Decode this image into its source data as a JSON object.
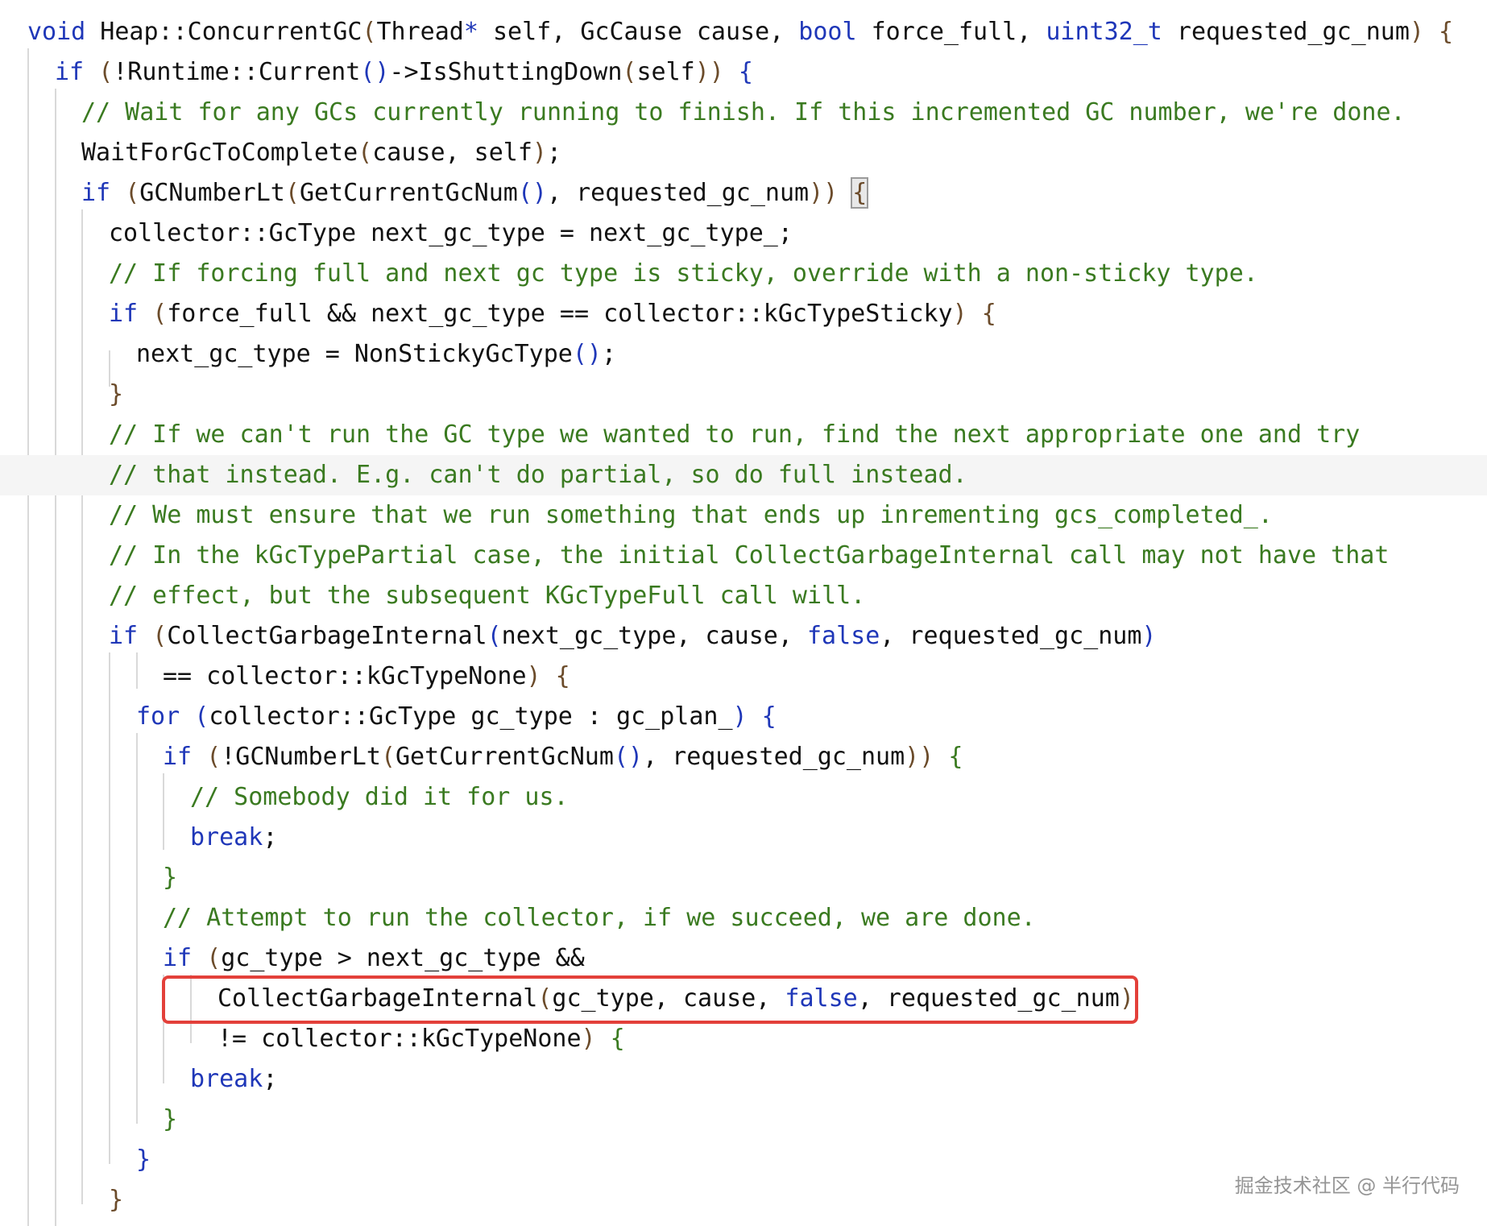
{
  "code": {
    "lines": [
      {
        "segments": [
          [
            "kw",
            "void"
          ],
          [
            "",
            " Heap::ConcurrentGC"
          ],
          [
            "pn",
            "("
          ],
          [
            "",
            "Thread"
          ],
          [
            "kw",
            "*"
          ],
          [
            "",
            " self, GcCause cause, "
          ],
          [
            "kw",
            "bool"
          ],
          [
            "",
            " force_full, "
          ],
          [
            "kw",
            "uint32_t"
          ],
          [
            "",
            " requested_gc_num"
          ],
          [
            "pn",
            ")"
          ],
          [
            "pn",
            " {"
          ]
        ]
      },
      {
        "segments": [
          [
            "kw",
            "if"
          ],
          [
            "",
            " "
          ],
          [
            "pn",
            "("
          ],
          [
            "",
            "!Runtime::Current"
          ],
          [
            "pr",
            "()"
          ],
          [
            "",
            "->IsShuttingDown"
          ],
          [
            "pn",
            "("
          ],
          [
            "",
            "self"
          ],
          [
            "pn",
            "))"
          ],
          [
            "pr",
            " {"
          ]
        ]
      },
      {
        "segments": [
          [
            "cm",
            "// Wait for any GCs currently running to finish. If this incremented GC number, we're done."
          ]
        ]
      },
      {
        "segments": [
          [
            "",
            "WaitForGcToComplete"
          ],
          [
            "pn",
            "("
          ],
          [
            "",
            "cause, self"
          ],
          [
            "pn",
            ")"
          ],
          [
            "",
            ";"
          ]
        ]
      },
      {
        "segments": [
          [
            "kw",
            "if"
          ],
          [
            "",
            " "
          ],
          [
            "pn",
            "("
          ],
          [
            "",
            "GCNumberLt"
          ],
          [
            "pn",
            "("
          ],
          [
            "",
            "GetCurrentGcNum"
          ],
          [
            "pr",
            "()"
          ],
          [
            "",
            ", requested_gc_num"
          ],
          [
            "pn",
            "))"
          ],
          [
            "",
            " "
          ],
          [
            "brace",
            "{"
          ]
        ]
      },
      {
        "segments": [
          [
            "",
            "collector::GcType next_gc_type = next_gc_type_;"
          ]
        ]
      },
      {
        "segments": [
          [
            "cm",
            "// If forcing full and next gc type is sticky, override with a non-sticky type."
          ]
        ]
      },
      {
        "segments": [
          [
            "kw",
            "if"
          ],
          [
            "",
            " "
          ],
          [
            "pn",
            "("
          ],
          [
            "",
            "force_full && next_gc_type == collector::kGcTypeSticky"
          ],
          [
            "pn",
            ")"
          ],
          [
            "pn",
            " {"
          ]
        ]
      },
      {
        "segments": [
          [
            "",
            "next_gc_type = NonStickyGcType"
          ],
          [
            "pr",
            "()"
          ],
          [
            "",
            ";"
          ]
        ]
      },
      {
        "segments": [
          [
            "pn",
            "}"
          ]
        ]
      },
      {
        "segments": [
          [
            "cm",
            "// If we can't run the GC type we wanted to run, find the next appropriate one and try"
          ]
        ]
      },
      {
        "segments": [
          [
            "cm",
            "// that instead. E.g. can't do partial, so do full instead."
          ]
        ]
      },
      {
        "segments": [
          [
            "cm",
            "// We must ensure that we run something that ends up inrementing gcs_completed_."
          ]
        ]
      },
      {
        "segments": [
          [
            "cm",
            "// In the kGcTypePartial case, the initial CollectGarbageInternal call may not have that"
          ]
        ]
      },
      {
        "segments": [
          [
            "cm",
            "// effect, but the subsequent KGcTypeFull call will."
          ]
        ]
      },
      {
        "segments": [
          [
            "kw",
            "if"
          ],
          [
            "",
            " "
          ],
          [
            "pn",
            "("
          ],
          [
            "",
            "CollectGarbageInternal"
          ],
          [
            "pr",
            "("
          ],
          [
            "",
            "next_gc_type, cause, "
          ],
          [
            "kw",
            "false"
          ],
          [
            "",
            ", requested_gc_num"
          ],
          [
            "pr",
            ")"
          ]
        ]
      },
      {
        "segments": [
          [
            "",
            "== collector::kGcTypeNone"
          ],
          [
            "pn",
            ")"
          ],
          [
            "pn",
            " {"
          ]
        ]
      },
      {
        "segments": [
          [
            "kw",
            "for"
          ],
          [
            "",
            " "
          ],
          [
            "pr",
            "("
          ],
          [
            "",
            "collector::GcType gc_type : gc_plan_"
          ],
          [
            "pr",
            ")"
          ],
          [
            "pr",
            " {"
          ]
        ]
      },
      {
        "segments": [
          [
            "kw",
            "if"
          ],
          [
            "",
            " "
          ],
          [
            "pn",
            "("
          ],
          [
            "",
            "!GCNumberLt"
          ],
          [
            "pn",
            "("
          ],
          [
            "",
            "GetCurrentGcNum"
          ],
          [
            "pr",
            "()"
          ],
          [
            "",
            ", requested_gc_num"
          ],
          [
            "pn",
            "))"
          ],
          [
            "cm",
            " {"
          ]
        ]
      },
      {
        "segments": [
          [
            "cm",
            "// Somebody did it for us."
          ]
        ]
      },
      {
        "segments": [
          [
            "kw",
            "break"
          ],
          [
            "",
            ";"
          ]
        ]
      },
      {
        "segments": [
          [
            "cm",
            "}"
          ]
        ]
      },
      {
        "segments": [
          [
            "cm",
            "// Attempt to run the collector, if we succeed, we are done."
          ]
        ]
      },
      {
        "segments": [
          [
            "kw",
            "if"
          ],
          [
            "",
            " "
          ],
          [
            "pn",
            "("
          ],
          [
            "",
            "gc_type > next_gc_type &&"
          ]
        ]
      },
      {
        "segments": [
          [
            "",
            "CollectGarbageInternal"
          ],
          [
            "pn",
            "("
          ],
          [
            "",
            "gc_type, cause, "
          ],
          [
            "kw",
            "false"
          ],
          [
            "",
            ", requested_gc_num"
          ],
          [
            "pn",
            ")"
          ]
        ]
      },
      {
        "segments": [
          [
            "",
            "!= collector::kGcTypeNone"
          ],
          [
            "pn",
            ")"
          ],
          [
            "cm",
            " {"
          ]
        ]
      },
      {
        "segments": [
          [
            "kw",
            "break"
          ],
          [
            "",
            ";"
          ]
        ]
      },
      {
        "segments": [
          [
            "cm",
            "}"
          ]
        ]
      },
      {
        "segments": [
          [
            "pr",
            "}"
          ]
        ]
      },
      {
        "segments": [
          [
            "pn",
            "}"
          ]
        ]
      }
    ]
  },
  "colors": {
    "keyword": "#1f37b8",
    "comment": "#3a7a20",
    "paren": "#6b4b2a",
    "highlight_box": "#e3403a"
  },
  "watermark": "掘金技术社区 @ 半行代码"
}
